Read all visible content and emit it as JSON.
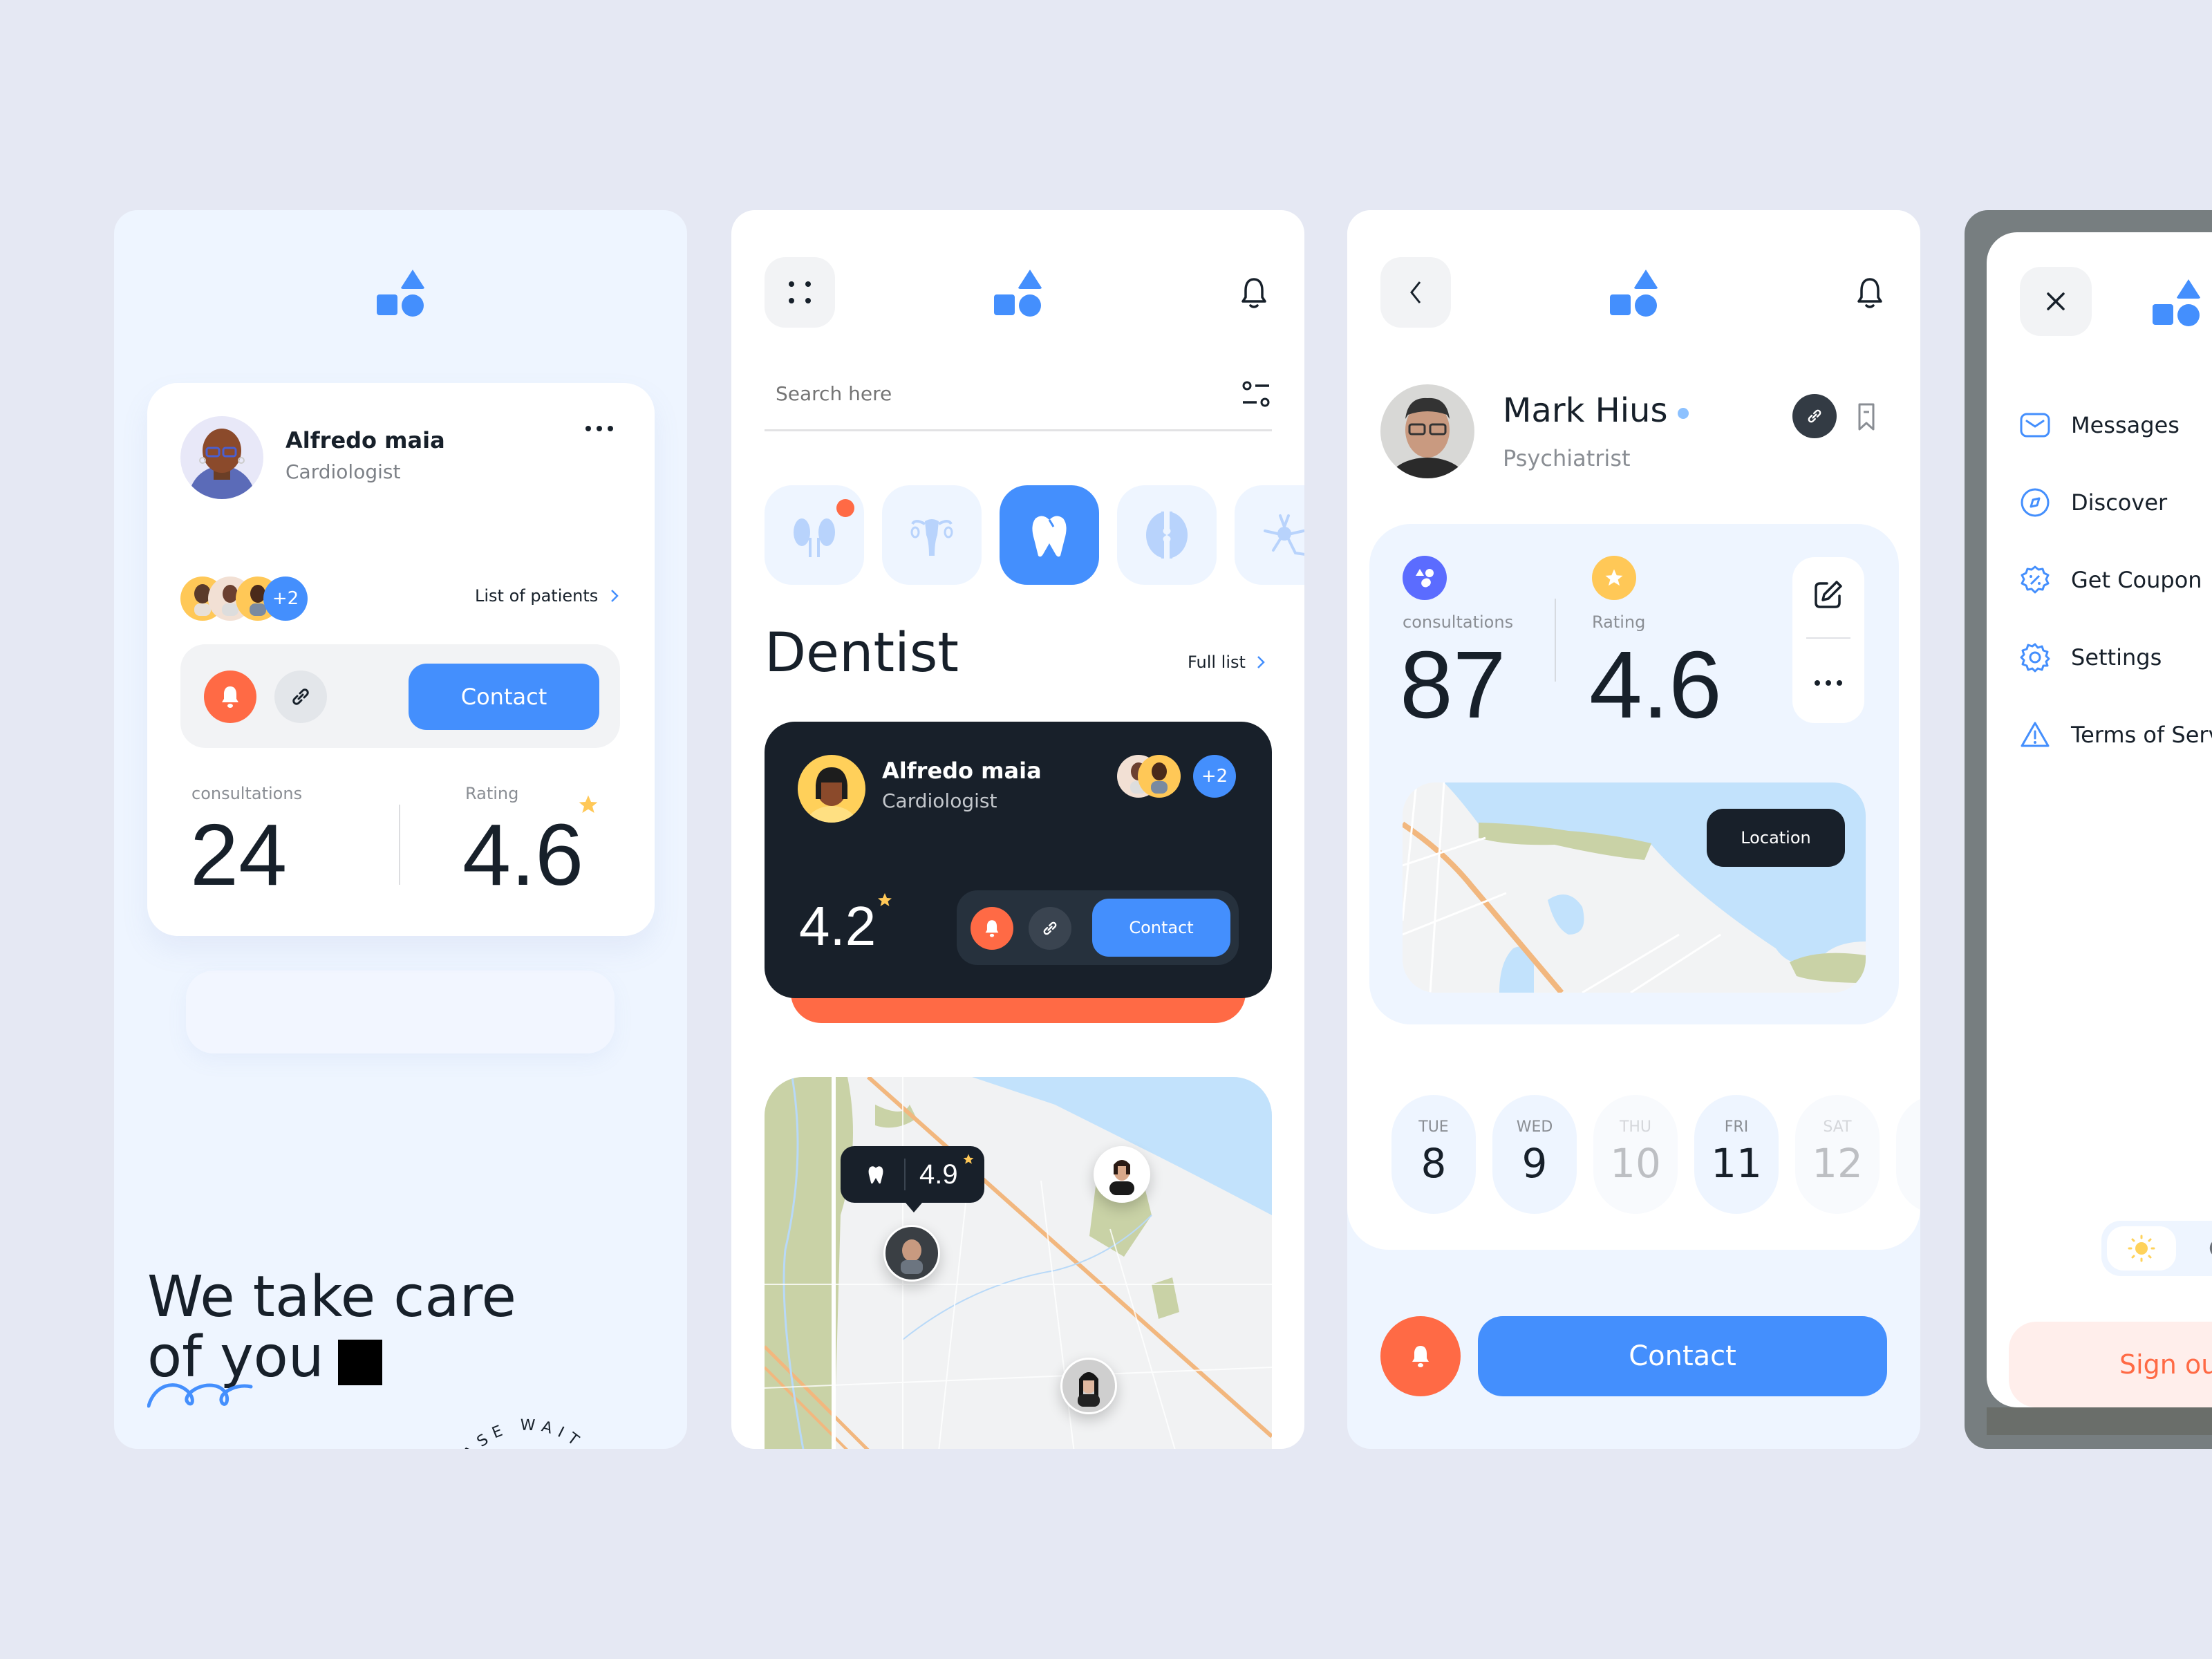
{
  "colors": {
    "background": "#e5e8f3",
    "accent_blue": "#448ffd",
    "accent_orange": "#ff6a45",
    "dark": "#18202a",
    "light_blue": "#eef5ff",
    "star_yellow": "#ffc857",
    "consult_purple": "#5b6cff"
  },
  "panel1": {
    "doctor": {
      "name": "Alfredo maia",
      "specialty": "Cardiologist"
    },
    "more_icon": "more-horizontal-icon",
    "patients": {
      "extra_count": "+2",
      "link_label": "List of patients"
    },
    "actions": {
      "contact_label": "Contact"
    },
    "stats": {
      "consultations_label": "consultations",
      "consultations_value": "24",
      "rating_label": "Rating",
      "rating_value": "4.6"
    },
    "headline": {
      "line1": "We take care",
      "line2": "of you"
    },
    "circular_text": "PLEASE WAIT - PLEASE WAIT - "
  },
  "panel2": {
    "search": {
      "placeholder": "Search here"
    },
    "categories": [
      {
        "name": "kidney",
        "icon": "kidney-icon",
        "selected": false,
        "badge": true
      },
      {
        "name": "uterus",
        "icon": "uterus-icon",
        "selected": false,
        "badge": false
      },
      {
        "name": "tooth",
        "icon": "tooth-icon",
        "selected": true,
        "badge": false
      },
      {
        "name": "joint",
        "icon": "joint-icon",
        "selected": false,
        "badge": false
      },
      {
        "name": "neuron",
        "icon": "neuron-icon",
        "selected": false,
        "badge": false
      }
    ],
    "section_title": "Dentist",
    "full_list_label": "Full list",
    "doctor_card": {
      "name": "Alfredo maia",
      "specialty": "Cardiologist",
      "rating": "4.2",
      "extra_count": "+2",
      "contact_label": "Contact"
    },
    "map": {
      "tooltip_rating": "4.9"
    }
  },
  "panel3": {
    "doctor": {
      "name": "Mark Hius",
      "specialty": "Psychiatrist"
    },
    "stats": {
      "consultations_label": "consultations",
      "consultations_value": "87",
      "rating_label": "Rating",
      "rating_value": "4.6"
    },
    "location_label": "Location",
    "days": [
      {
        "dow": "TUE",
        "num": "8",
        "available": true
      },
      {
        "dow": "WED",
        "num": "9",
        "available": true
      },
      {
        "dow": "THU",
        "num": "10",
        "available": false
      },
      {
        "dow": "FRI",
        "num": "11",
        "available": true
      },
      {
        "dow": "SAT",
        "num": "12",
        "available": false
      }
    ],
    "contact_label": "Contact"
  },
  "panel4": {
    "menu": [
      {
        "label": "Messages",
        "icon": "mail-icon"
      },
      {
        "label": "Discover",
        "icon": "compass-icon"
      },
      {
        "label": "Get Coupon",
        "icon": "coupon-icon"
      },
      {
        "label": "Settings",
        "icon": "gear-icon"
      },
      {
        "label": "Terms of Serv",
        "icon": "warning-icon"
      }
    ],
    "theme": "light",
    "sign_out_label": "Sign ou"
  }
}
